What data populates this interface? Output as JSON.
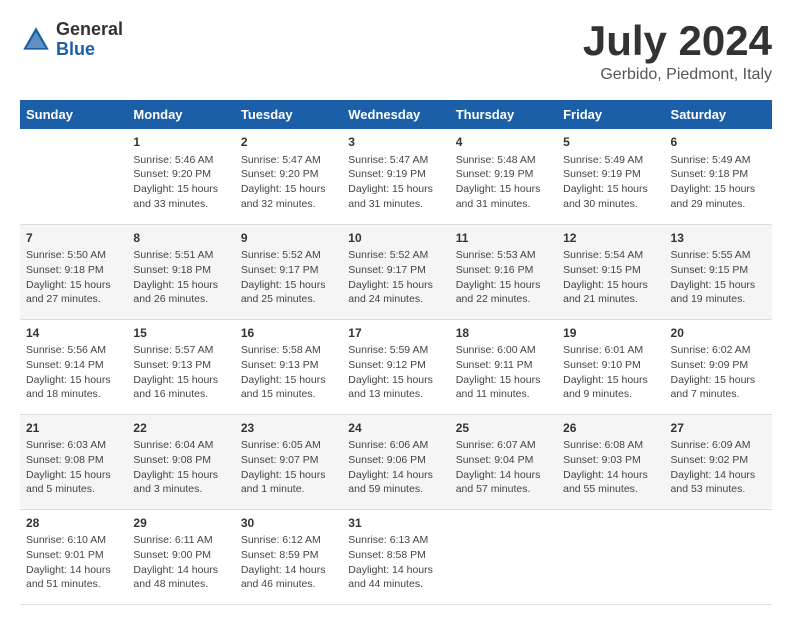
{
  "logo": {
    "general": "General",
    "blue": "Blue"
  },
  "header": {
    "month_year": "July 2024",
    "location": "Gerbido, Piedmont, Italy"
  },
  "days_of_week": [
    "Sunday",
    "Monday",
    "Tuesday",
    "Wednesday",
    "Thursday",
    "Friday",
    "Saturday"
  ],
  "weeks": [
    [
      {
        "day": "",
        "info": ""
      },
      {
        "day": "1",
        "info": "Sunrise: 5:46 AM\nSunset: 9:20 PM\nDaylight: 15 hours\nand 33 minutes."
      },
      {
        "day": "2",
        "info": "Sunrise: 5:47 AM\nSunset: 9:20 PM\nDaylight: 15 hours\nand 32 minutes."
      },
      {
        "day": "3",
        "info": "Sunrise: 5:47 AM\nSunset: 9:19 PM\nDaylight: 15 hours\nand 31 minutes."
      },
      {
        "day": "4",
        "info": "Sunrise: 5:48 AM\nSunset: 9:19 PM\nDaylight: 15 hours\nand 31 minutes."
      },
      {
        "day": "5",
        "info": "Sunrise: 5:49 AM\nSunset: 9:19 PM\nDaylight: 15 hours\nand 30 minutes."
      },
      {
        "day": "6",
        "info": "Sunrise: 5:49 AM\nSunset: 9:18 PM\nDaylight: 15 hours\nand 29 minutes."
      }
    ],
    [
      {
        "day": "7",
        "info": "Sunrise: 5:50 AM\nSunset: 9:18 PM\nDaylight: 15 hours\nand 27 minutes."
      },
      {
        "day": "8",
        "info": "Sunrise: 5:51 AM\nSunset: 9:18 PM\nDaylight: 15 hours\nand 26 minutes."
      },
      {
        "day": "9",
        "info": "Sunrise: 5:52 AM\nSunset: 9:17 PM\nDaylight: 15 hours\nand 25 minutes."
      },
      {
        "day": "10",
        "info": "Sunrise: 5:52 AM\nSunset: 9:17 PM\nDaylight: 15 hours\nand 24 minutes."
      },
      {
        "day": "11",
        "info": "Sunrise: 5:53 AM\nSunset: 9:16 PM\nDaylight: 15 hours\nand 22 minutes."
      },
      {
        "day": "12",
        "info": "Sunrise: 5:54 AM\nSunset: 9:15 PM\nDaylight: 15 hours\nand 21 minutes."
      },
      {
        "day": "13",
        "info": "Sunrise: 5:55 AM\nSunset: 9:15 PM\nDaylight: 15 hours\nand 19 minutes."
      }
    ],
    [
      {
        "day": "14",
        "info": "Sunrise: 5:56 AM\nSunset: 9:14 PM\nDaylight: 15 hours\nand 18 minutes."
      },
      {
        "day": "15",
        "info": "Sunrise: 5:57 AM\nSunset: 9:13 PM\nDaylight: 15 hours\nand 16 minutes."
      },
      {
        "day": "16",
        "info": "Sunrise: 5:58 AM\nSunset: 9:13 PM\nDaylight: 15 hours\nand 15 minutes."
      },
      {
        "day": "17",
        "info": "Sunrise: 5:59 AM\nSunset: 9:12 PM\nDaylight: 15 hours\nand 13 minutes."
      },
      {
        "day": "18",
        "info": "Sunrise: 6:00 AM\nSunset: 9:11 PM\nDaylight: 15 hours\nand 11 minutes."
      },
      {
        "day": "19",
        "info": "Sunrise: 6:01 AM\nSunset: 9:10 PM\nDaylight: 15 hours\nand 9 minutes."
      },
      {
        "day": "20",
        "info": "Sunrise: 6:02 AM\nSunset: 9:09 PM\nDaylight: 15 hours\nand 7 minutes."
      }
    ],
    [
      {
        "day": "21",
        "info": "Sunrise: 6:03 AM\nSunset: 9:08 PM\nDaylight: 15 hours\nand 5 minutes."
      },
      {
        "day": "22",
        "info": "Sunrise: 6:04 AM\nSunset: 9:08 PM\nDaylight: 15 hours\nand 3 minutes."
      },
      {
        "day": "23",
        "info": "Sunrise: 6:05 AM\nSunset: 9:07 PM\nDaylight: 15 hours\nand 1 minute."
      },
      {
        "day": "24",
        "info": "Sunrise: 6:06 AM\nSunset: 9:06 PM\nDaylight: 14 hours\nand 59 minutes."
      },
      {
        "day": "25",
        "info": "Sunrise: 6:07 AM\nSunset: 9:04 PM\nDaylight: 14 hours\nand 57 minutes."
      },
      {
        "day": "26",
        "info": "Sunrise: 6:08 AM\nSunset: 9:03 PM\nDaylight: 14 hours\nand 55 minutes."
      },
      {
        "day": "27",
        "info": "Sunrise: 6:09 AM\nSunset: 9:02 PM\nDaylight: 14 hours\nand 53 minutes."
      }
    ],
    [
      {
        "day": "28",
        "info": "Sunrise: 6:10 AM\nSunset: 9:01 PM\nDaylight: 14 hours\nand 51 minutes."
      },
      {
        "day": "29",
        "info": "Sunrise: 6:11 AM\nSunset: 9:00 PM\nDaylight: 14 hours\nand 48 minutes."
      },
      {
        "day": "30",
        "info": "Sunrise: 6:12 AM\nSunset: 8:59 PM\nDaylight: 14 hours\nand 46 minutes."
      },
      {
        "day": "31",
        "info": "Sunrise: 6:13 AM\nSunset: 8:58 PM\nDaylight: 14 hours\nand 44 minutes."
      },
      {
        "day": "",
        "info": ""
      },
      {
        "day": "",
        "info": ""
      },
      {
        "day": "",
        "info": ""
      }
    ]
  ]
}
